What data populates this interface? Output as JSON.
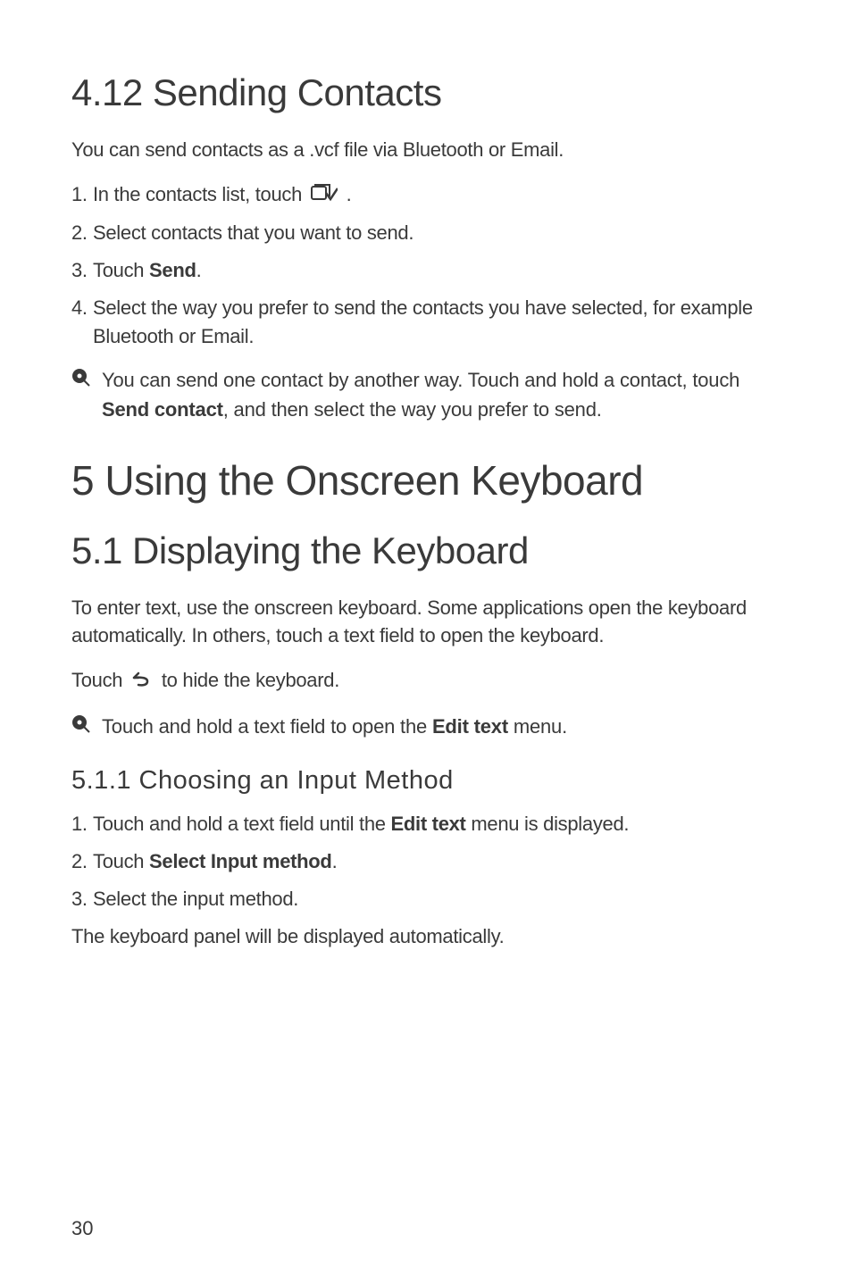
{
  "section412": {
    "heading": "4.12  Sending Contacts",
    "intro": "You can send contacts as a .vcf file via Bluetooth or Email.",
    "steps": [
      {
        "num": "1.",
        "before": "In the contacts list, touch ",
        "after": " ."
      },
      {
        "num": "2.",
        "text": "Select contacts that you want to send."
      },
      {
        "num": "3.",
        "before": "Touch ",
        "bold": "Send",
        "after": "."
      },
      {
        "num": "4.",
        "text": "Select the way you prefer to send the contacts you have selected, for example Bluetooth or Email."
      }
    ],
    "note": {
      "before": "You can send one contact by another way. Touch and hold a contact, touch ",
      "bold": "Send contact",
      "after": ", and then select the way you prefer to send."
    }
  },
  "chapter5": {
    "heading": "5  Using the Onscreen Keyboard"
  },
  "section51": {
    "heading": "5.1  Displaying the Keyboard",
    "intro": "To enter text, use the onscreen keyboard. Some applications open the keyboard automatically. In others, touch a text field to open the keyboard.",
    "touchLine": {
      "before": "Touch ",
      "after": " to hide the keyboard."
    },
    "note": {
      "before": "Touch and hold a text field to open the ",
      "bold": "Edit text",
      "after": " menu."
    }
  },
  "section511": {
    "heading": "5.1.1  Choosing an Input Method",
    "steps": [
      {
        "num": "1.",
        "before": "Touch and hold a text field until the ",
        "bold": "Edit text",
        "after": " menu is displayed."
      },
      {
        "num": "2.",
        "before": "Touch ",
        "bold": "Select Input method",
        "after": "."
      },
      {
        "num": "3.",
        "text": "Select the input method."
      }
    ],
    "closing": "The keyboard panel will be displayed automatically."
  },
  "pageNumber": "30"
}
